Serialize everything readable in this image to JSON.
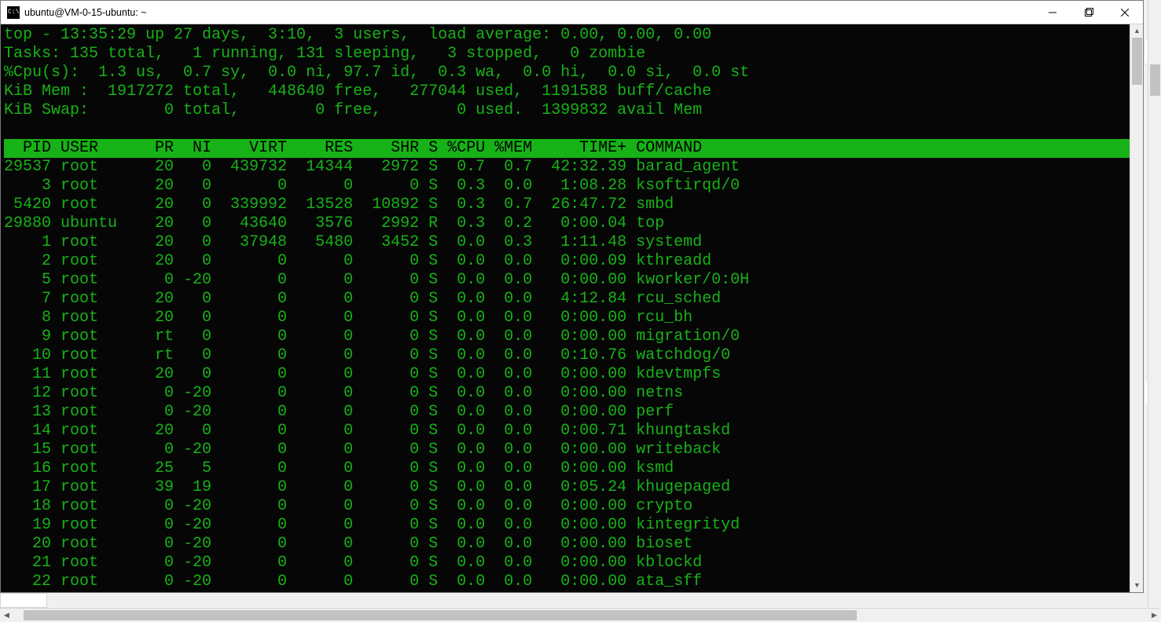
{
  "window": {
    "title": "ubuntu@VM-0-15-ubuntu: ~"
  },
  "summary": {
    "line1": "top - 13:35:29 up 27 days,  3:10,  3 users,  load average: 0.00, 0.00, 0.00",
    "line2": "Tasks: 135 total,   1 running, 131 sleeping,   3 stopped,   0 zombie",
    "line3": "%Cpu(s):  1.3 us,  0.7 sy,  0.0 ni, 97.7 id,  0.3 wa,  0.0 hi,  0.0 si,  0.0 st",
    "line4": "KiB Mem :  1917272 total,   448640 free,   277044 used,  1191588 buff/cache",
    "line5": "KiB Swap:        0 total,        0 free,        0 used.  1399832 avail Mem"
  },
  "columns": [
    "PID",
    "USER",
    "PR",
    "NI",
    "VIRT",
    "RES",
    "SHR",
    "S",
    "%CPU",
    "%MEM",
    "TIME+",
    "COMMAND"
  ],
  "header_line": "  PID USER      PR  NI    VIRT    RES    SHR S %CPU %MEM     TIME+ COMMAND",
  "processes": [
    {
      "pid": "29537",
      "user": "root",
      "pr": "20",
      "ni": "0",
      "virt": "439732",
      "res": "14344",
      "shr": "2972",
      "s": "S",
      "cpu": "0.7",
      "mem": "0.7",
      "time": "42:32.39",
      "cmd": "barad_agent"
    },
    {
      "pid": "3",
      "user": "root",
      "pr": "20",
      "ni": "0",
      "virt": "0",
      "res": "0",
      "shr": "0",
      "s": "S",
      "cpu": "0.3",
      "mem": "0.0",
      "time": "1:08.28",
      "cmd": "ksoftirqd/0"
    },
    {
      "pid": "5420",
      "user": "root",
      "pr": "20",
      "ni": "0",
      "virt": "339992",
      "res": "13528",
      "shr": "10892",
      "s": "S",
      "cpu": "0.3",
      "mem": "0.7",
      "time": "26:47.72",
      "cmd": "smbd"
    },
    {
      "pid": "29880",
      "user": "ubuntu",
      "pr": "20",
      "ni": "0",
      "virt": "43640",
      "res": "3576",
      "shr": "2992",
      "s": "R",
      "cpu": "0.3",
      "mem": "0.2",
      "time": "0:00.04",
      "cmd": "top"
    },
    {
      "pid": "1",
      "user": "root",
      "pr": "20",
      "ni": "0",
      "virt": "37948",
      "res": "5480",
      "shr": "3452",
      "s": "S",
      "cpu": "0.0",
      "mem": "0.3",
      "time": "1:11.48",
      "cmd": "systemd"
    },
    {
      "pid": "2",
      "user": "root",
      "pr": "20",
      "ni": "0",
      "virt": "0",
      "res": "0",
      "shr": "0",
      "s": "S",
      "cpu": "0.0",
      "mem": "0.0",
      "time": "0:00.09",
      "cmd": "kthreadd"
    },
    {
      "pid": "5",
      "user": "root",
      "pr": "0",
      "ni": "-20",
      "virt": "0",
      "res": "0",
      "shr": "0",
      "s": "S",
      "cpu": "0.0",
      "mem": "0.0",
      "time": "0:00.00",
      "cmd": "kworker/0:0H"
    },
    {
      "pid": "7",
      "user": "root",
      "pr": "20",
      "ni": "0",
      "virt": "0",
      "res": "0",
      "shr": "0",
      "s": "S",
      "cpu": "0.0",
      "mem": "0.0",
      "time": "4:12.84",
      "cmd": "rcu_sched"
    },
    {
      "pid": "8",
      "user": "root",
      "pr": "20",
      "ni": "0",
      "virt": "0",
      "res": "0",
      "shr": "0",
      "s": "S",
      "cpu": "0.0",
      "mem": "0.0",
      "time": "0:00.00",
      "cmd": "rcu_bh"
    },
    {
      "pid": "9",
      "user": "root",
      "pr": "rt",
      "ni": "0",
      "virt": "0",
      "res": "0",
      "shr": "0",
      "s": "S",
      "cpu": "0.0",
      "mem": "0.0",
      "time": "0:00.00",
      "cmd": "migration/0"
    },
    {
      "pid": "10",
      "user": "root",
      "pr": "rt",
      "ni": "0",
      "virt": "0",
      "res": "0",
      "shr": "0",
      "s": "S",
      "cpu": "0.0",
      "mem": "0.0",
      "time": "0:10.76",
      "cmd": "watchdog/0"
    },
    {
      "pid": "11",
      "user": "root",
      "pr": "20",
      "ni": "0",
      "virt": "0",
      "res": "0",
      "shr": "0",
      "s": "S",
      "cpu": "0.0",
      "mem": "0.0",
      "time": "0:00.00",
      "cmd": "kdevtmpfs"
    },
    {
      "pid": "12",
      "user": "root",
      "pr": "0",
      "ni": "-20",
      "virt": "0",
      "res": "0",
      "shr": "0",
      "s": "S",
      "cpu": "0.0",
      "mem": "0.0",
      "time": "0:00.00",
      "cmd": "netns"
    },
    {
      "pid": "13",
      "user": "root",
      "pr": "0",
      "ni": "-20",
      "virt": "0",
      "res": "0",
      "shr": "0",
      "s": "S",
      "cpu": "0.0",
      "mem": "0.0",
      "time": "0:00.00",
      "cmd": "perf"
    },
    {
      "pid": "14",
      "user": "root",
      "pr": "20",
      "ni": "0",
      "virt": "0",
      "res": "0",
      "shr": "0",
      "s": "S",
      "cpu": "0.0",
      "mem": "0.0",
      "time": "0:00.71",
      "cmd": "khungtaskd"
    },
    {
      "pid": "15",
      "user": "root",
      "pr": "0",
      "ni": "-20",
      "virt": "0",
      "res": "0",
      "shr": "0",
      "s": "S",
      "cpu": "0.0",
      "mem": "0.0",
      "time": "0:00.00",
      "cmd": "writeback"
    },
    {
      "pid": "16",
      "user": "root",
      "pr": "25",
      "ni": "5",
      "virt": "0",
      "res": "0",
      "shr": "0",
      "s": "S",
      "cpu": "0.0",
      "mem": "0.0",
      "time": "0:00.00",
      "cmd": "ksmd"
    },
    {
      "pid": "17",
      "user": "root",
      "pr": "39",
      "ni": "19",
      "virt": "0",
      "res": "0",
      "shr": "0",
      "s": "S",
      "cpu": "0.0",
      "mem": "0.0",
      "time": "0:05.24",
      "cmd": "khugepaged"
    },
    {
      "pid": "18",
      "user": "root",
      "pr": "0",
      "ni": "-20",
      "virt": "0",
      "res": "0",
      "shr": "0",
      "s": "S",
      "cpu": "0.0",
      "mem": "0.0",
      "time": "0:00.00",
      "cmd": "crypto"
    },
    {
      "pid": "19",
      "user": "root",
      "pr": "0",
      "ni": "-20",
      "virt": "0",
      "res": "0",
      "shr": "0",
      "s": "S",
      "cpu": "0.0",
      "mem": "0.0",
      "time": "0:00.00",
      "cmd": "kintegrityd"
    },
    {
      "pid": "20",
      "user": "root",
      "pr": "0",
      "ni": "-20",
      "virt": "0",
      "res": "0",
      "shr": "0",
      "s": "S",
      "cpu": "0.0",
      "mem": "0.0",
      "time": "0:00.00",
      "cmd": "bioset"
    },
    {
      "pid": "21",
      "user": "root",
      "pr": "0",
      "ni": "-20",
      "virt": "0",
      "res": "0",
      "shr": "0",
      "s": "S",
      "cpu": "0.0",
      "mem": "0.0",
      "time": "0:00.00",
      "cmd": "kblockd"
    },
    {
      "pid": "22",
      "user": "root",
      "pr": "0",
      "ni": "-20",
      "virt": "0",
      "res": "0",
      "shr": "0",
      "s": "S",
      "cpu": "0.0",
      "mem": "0.0",
      "time": "0:00.00",
      "cmd": "ata_sff"
    }
  ],
  "colors": {
    "term_bg": "#060606",
    "term_fg": "#17b217",
    "header_bg": "#17b217",
    "header_fg": "#000000"
  }
}
